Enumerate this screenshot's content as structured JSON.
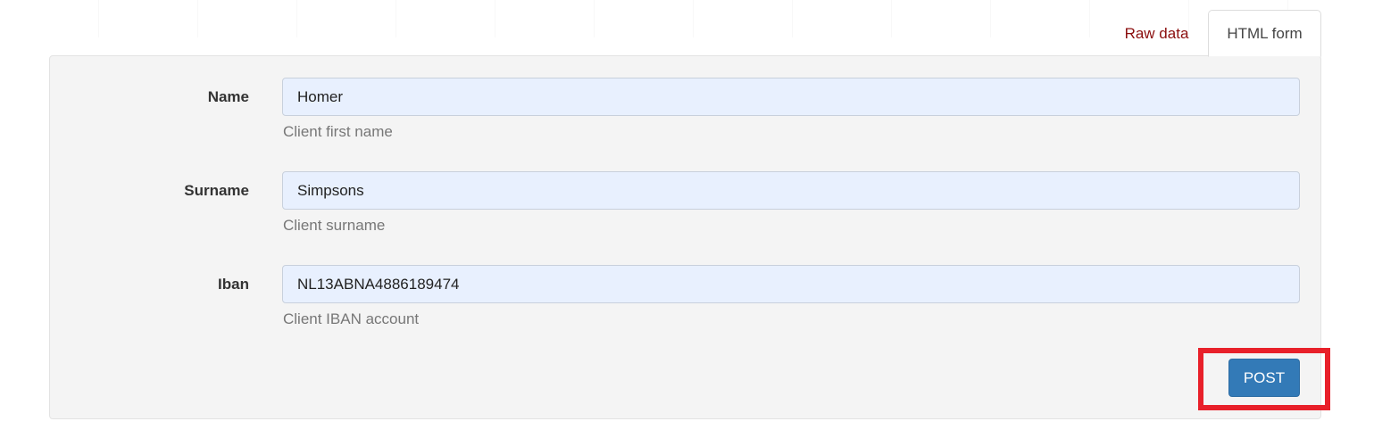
{
  "tabs": {
    "raw_label": "Raw data",
    "html_label": "HTML form"
  },
  "form": {
    "fields": [
      {
        "label": "Name",
        "value": "Homer",
        "help": "Client first name"
      },
      {
        "label": "Surname",
        "value": "Simpsons",
        "help": "Client surname"
      },
      {
        "label": "Iban",
        "value": "NL13ABNA4886189474",
        "help": "Client IBAN account"
      }
    ],
    "submit_label": "POST"
  },
  "colors": {
    "accent": "#337ab7",
    "tab_link": "#8b0e0e",
    "highlight": "#e8202a",
    "input_bg": "#e8f0fe"
  }
}
